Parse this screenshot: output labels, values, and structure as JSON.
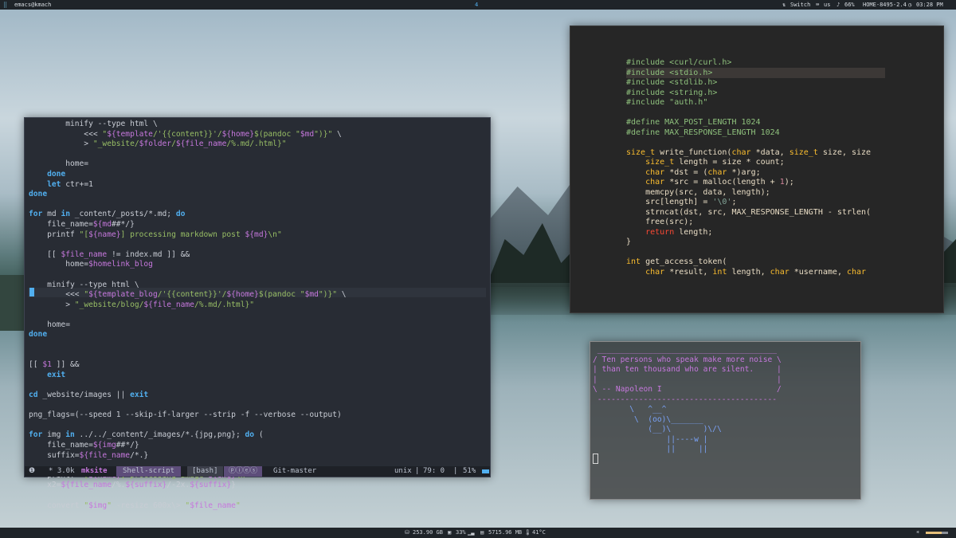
{
  "topbar": {
    "host": "emacs@kmach",
    "workspace": "4",
    "switch_label": "Switch",
    "kbd_layout": "us",
    "volume": "66%",
    "network": "HOME-8495-2.4",
    "time": "03:28 PM"
  },
  "bottombar": {
    "disk": "253.90 GB",
    "cpu": "33%",
    "ram": "5715.96 MB",
    "temp": "41°C"
  },
  "emacs": {
    "lines": [
      "        minify --type html \\",
      "            <<< \"${template/'{{content}}'/${home}$(pandoc \"$md\")}\" \\",
      "            > \"_website/$folder/${file_name/%.md/.html}\"",
      "",
      "        home=",
      "    done",
      "    let ctr+=1",
      "done",
      "",
      "for md in _content/_posts/*.md; do",
      "    file_name=${md##*/}",
      "    printf \"[${name}] processing markdown post ${md}\\n\"",
      "",
      "    [[ $file_name != index.md ]] &&",
      "        home=$homelink_blog",
      "",
      "    minify --type html \\",
      "        <<< \"${template_blog/'{{content}}'/${home}$(pandoc \"$md\")}\" \\",
      "        > \"_website/blog/${file_name/%.md/.html}\"",
      "",
      "    home=",
      "done",
      "",
      "",
      "[[ $1 ]] &&",
      "    exit",
      "",
      "cd _website/images || exit",
      "",
      "png_flags=(--speed 1 --skip-if-larger --strip -f --verbose --output)",
      "",
      "for img in ../../_content/_images/*.{jpg,png}; do (",
      "    file_name=${img##*/}",
      "    suffix=${file_name/*.}",
      "",
      "    printf \"[${name}] processing image ${img}\\n\"",
      "    x2=${file_name/%.${suffix}/-2x.${suffix}}",
      "",
      "    convert \"$img\" -resize 600x\\> \"$file_name\""
    ],
    "modeline": {
      "state": "❶",
      "buffer_size": "* 3.0k",
      "project": "mksite",
      "mode": "Shell-script",
      "process": "[bash]",
      "indicators": "ⓟⓘⓔⓢ",
      "vcs": "Git-master",
      "encoding": "unix",
      "position": "79: 0",
      "percent": "51%"
    }
  },
  "c_editor": {
    "lines": [
      "#include <curl/curl.h>",
      "#include <stdio.h>",
      "#include <stdlib.h>",
      "#include <string.h>",
      "#include \"auth.h\"",
      "",
      "#define MAX_POST_LENGTH 1024",
      "#define MAX_RESPONSE_LENGTH 1024",
      "",
      "size_t write_function(char *data, size_t size, size",
      "    size_t length = size * count;",
      "    char *dst = (char *)arg;",
      "    char *src = malloc(length + 1);",
      "    memcpy(src, data, length);",
      "    src[length] = '\\0';",
      "    strncat(dst, src, MAX_RESPONSE_LENGTH - strlen(",
      "    free(src);",
      "    return length;",
      "}",
      "",
      "int get_access_token(",
      "    char *result, int length, char *username, char"
    ]
  },
  "cowsay": {
    "lines": [
      " _______________________________________",
      "/ Ten persons who speak make more noise \\",
      "| than ten thousand who are silent.     |",
      "|                                       |",
      "\\ -- Napoleon I                         /",
      " ---------------------------------------",
      "        \\   ^__^",
      "         \\  (oo)\\_______",
      "            (__)\\       )\\/\\",
      "                ||----w |",
      "                ||     ||"
    ]
  }
}
